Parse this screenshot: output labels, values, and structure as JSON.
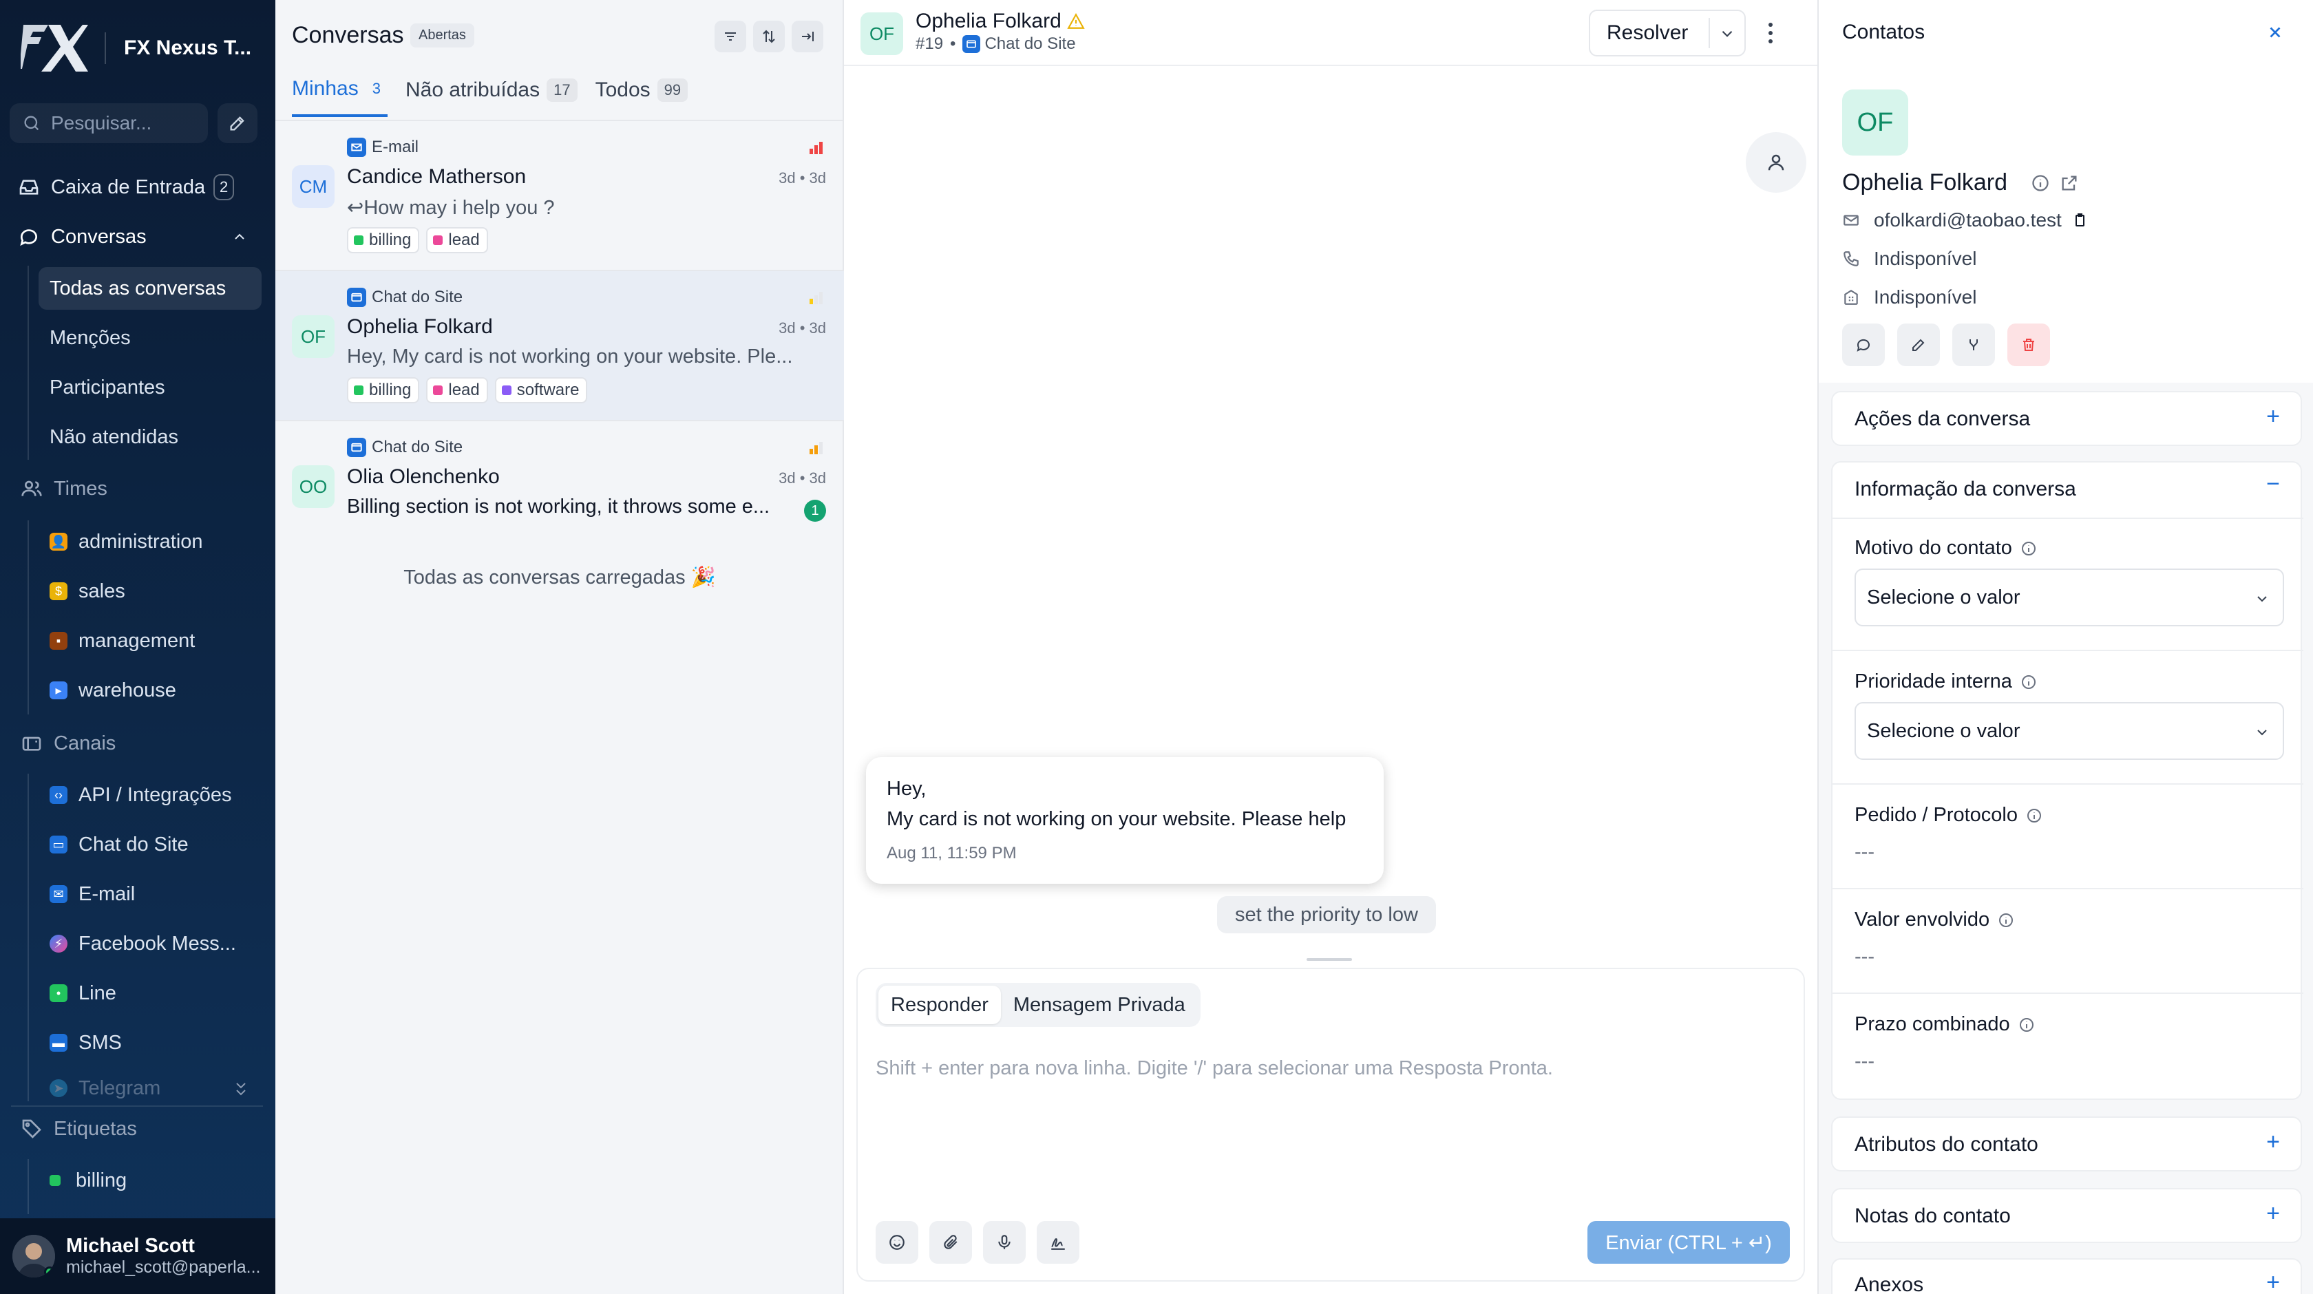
{
  "sidebar": {
    "brand": "FX Nexus T...",
    "search_placeholder": "Pesquisar...",
    "inbox": {
      "label": "Caixa de Entrada",
      "count": "2"
    },
    "conversations": {
      "label": "Conversas",
      "items": [
        "Todas as conversas",
        "Menções",
        "Participantes",
        "Não atendidas"
      ]
    },
    "teams": {
      "label": "Times",
      "items": [
        {
          "label": "administration",
          "emoji": "🧑‍💼",
          "color": "#f59e0b"
        },
        {
          "label": "sales",
          "emoji": "💰",
          "color": "#f59e0b"
        },
        {
          "label": "management",
          "emoji": "💼",
          "color": "#7c2d12"
        },
        {
          "label": "warehouse",
          "emoji": "🚚",
          "color": "#3b82f6"
        }
      ]
    },
    "channels": {
      "label": "Canais",
      "items": [
        {
          "label": "API / Integrações",
          "color": "#1d6fd8"
        },
        {
          "label": "Chat do Site",
          "color": "#1d6fd8"
        },
        {
          "label": "E-mail",
          "color": "#1d6fd8"
        },
        {
          "label": "Facebook Mess...",
          "color": "#a855f7"
        },
        {
          "label": "Line",
          "color": "#22c55e"
        },
        {
          "label": "SMS",
          "color": "#1d6fd8"
        },
        {
          "label": "Telegram",
          "color": "#38bdf8"
        }
      ]
    },
    "labels": {
      "label": "Etiquetas",
      "items": [
        {
          "label": "billing",
          "color": "#22c55e"
        }
      ]
    },
    "user": {
      "name": "Michael Scott",
      "email": "michael_scott@paperla..."
    }
  },
  "list": {
    "title": "Conversas",
    "status_badge": "Abertas",
    "tabs": [
      {
        "label": "Minhas",
        "count": "3"
      },
      {
        "label": "Não atribuídas",
        "count": "17"
      },
      {
        "label": "Todos",
        "count": "99"
      }
    ],
    "conversations": [
      {
        "initials": "CM",
        "channel": "E-mail",
        "name": "Candice Matherson",
        "time": "3d • 3d",
        "message": "How may i help you ?",
        "priority_color": "#ef4444",
        "tags": [
          {
            "label": "billing",
            "color": "#22c55e"
          },
          {
            "label": "lead",
            "color": "#ec4899"
          }
        ]
      },
      {
        "initials": "OF",
        "channel": "Chat do Site",
        "name": "Ophelia Folkard",
        "time": "3d • 3d",
        "message": "Hey, My card is not working on your website. Ple...",
        "priority_color": "#facc15",
        "tags": [
          {
            "label": "billing",
            "color": "#22c55e"
          },
          {
            "label": "lead",
            "color": "#ec4899"
          },
          {
            "label": "software",
            "color": "#8b5cf6"
          }
        ]
      },
      {
        "initials": "OO",
        "channel": "Chat do Site",
        "name": "Olia Olenchenko",
        "time": "3d • 3d",
        "message": "Billing section is not working, it throws some e...",
        "priority_color": "#f59e0b",
        "unread": "1",
        "tags": []
      }
    ],
    "all_loaded": "Todas as conversas carregadas 🎉"
  },
  "chat": {
    "initials": "OF",
    "contact_name": "Ophelia Folkard",
    "conversation_id": "#19",
    "channel": "Chat do Site",
    "resolve_label": "Resolver",
    "message_lines": [
      "Hey,",
      "My card is not working on your website. Please help"
    ],
    "message_time": "Aug 11, 11:59 PM",
    "activity": "set the priority to low",
    "composer": {
      "tabs": [
        "Responder",
        "Mensagem Privada"
      ],
      "placeholder": "Shift + enter para nova linha. Digite '/' para selecionar uma Resposta Pronta.",
      "send_label": "Enviar (CTRL + ↵)"
    }
  },
  "contact": {
    "title": "Contatos",
    "initials": "OF",
    "name": "Ophelia Folkard",
    "email": "ofolkardi@taobao.test",
    "phone": "Indisponível",
    "company": "Indisponível",
    "sections": {
      "actions": "Ações da conversa",
      "info": "Informação da conversa",
      "attributes": "Atributos do contato",
      "notes": "Notas do contato",
      "attachments": "Anexos"
    },
    "fields": {
      "reason": {
        "label": "Motivo do contato",
        "value": "Selecione o valor"
      },
      "priority": {
        "label": "Prioridade interna",
        "value": "Selecione o valor"
      },
      "order": {
        "label": "Pedido / Protocolo",
        "value": "---"
      },
      "amount": {
        "label": "Valor envolvido",
        "value": "---"
      },
      "deadline": {
        "label": "Prazo combinado",
        "value": "---"
      }
    }
  }
}
